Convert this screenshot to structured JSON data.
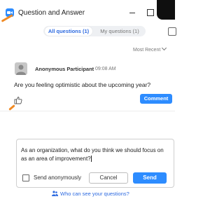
{
  "window": {
    "title": "Question and Answer",
    "app_icon": "zoom-camera-icon",
    "brand_color": "#2d8cff"
  },
  "tabs": [
    {
      "label": "All questions (1)",
      "active": true
    },
    {
      "label": "My questions (1)",
      "active": false
    }
  ],
  "sort": {
    "label": "Most Recent"
  },
  "question_item": {
    "participant": "Anonymous Participant",
    "time": "09:08 AM",
    "question": "Are you feeling optimistic about the upcoming year?",
    "comment_label": "Comment",
    "like_icon": "thumbs-up-icon"
  },
  "compose": {
    "text": "As an organization, what do you think we should focus on as an area of improvement?",
    "anonymous_label": "Send anonymously",
    "anonymous_checked": false,
    "cancel_label": "Cancel",
    "send_label": "Send"
  },
  "footer": {
    "link": "Who can see your questions?"
  },
  "colors": {
    "accent": "#f08a24",
    "link": "#2d6ae0"
  }
}
